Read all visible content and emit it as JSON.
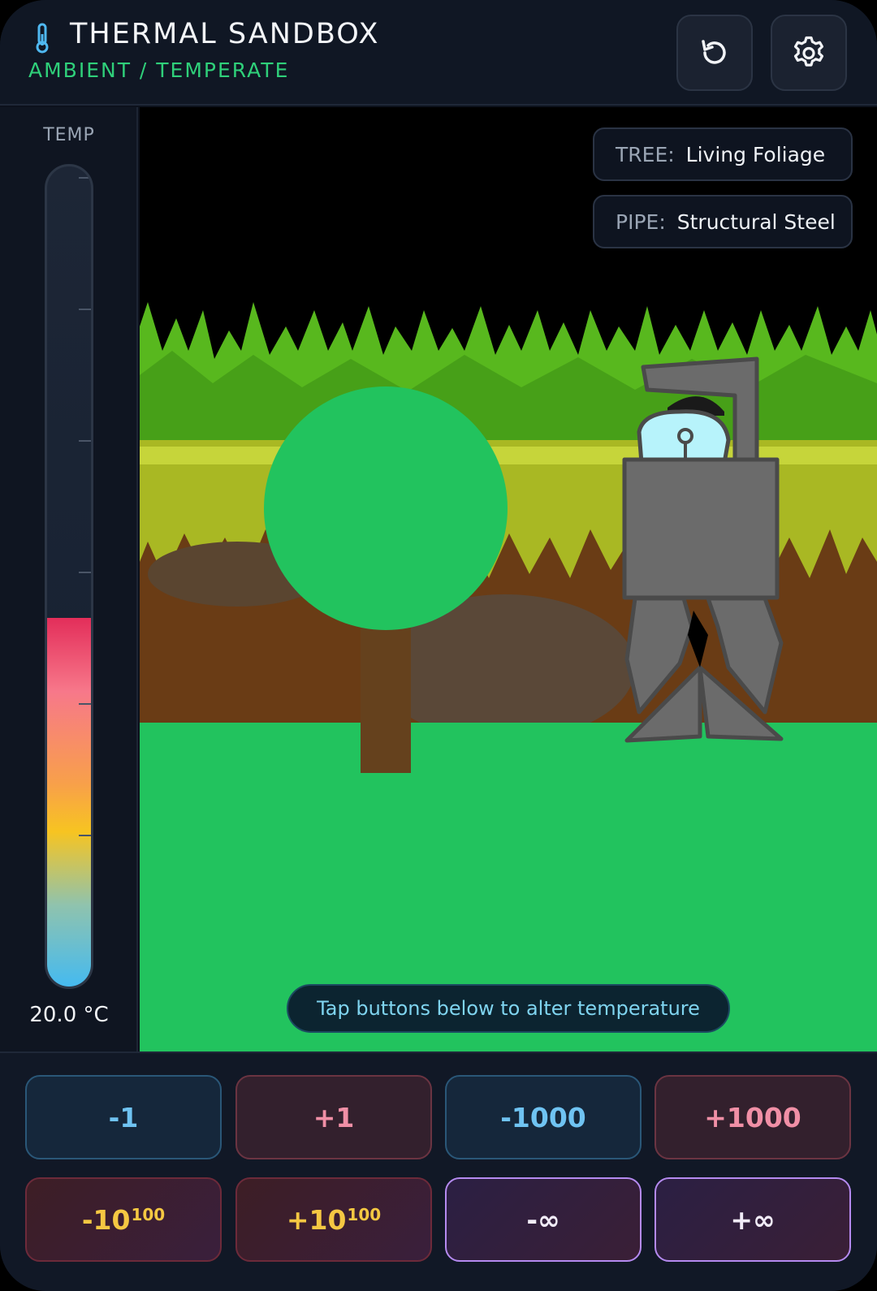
{
  "header": {
    "title": "THERMAL SANDBOX",
    "subtitle": "AMBIENT / TEMPERATE",
    "reset_icon": "reset-icon",
    "settings_icon": "gear-icon"
  },
  "thermometer": {
    "label": "TEMP",
    "readout": "20.0 °C",
    "fill_fraction": 0.45
  },
  "scene": {
    "tree_tag": {
      "key": "TREE:",
      "value": "Living Foliage"
    },
    "pipe_tag": {
      "key": "PIPE:",
      "value": "Structural Steel"
    },
    "hint": "Tap buttons below to alter temperature"
  },
  "controls": {
    "minus_1": "-1",
    "plus_1": "+1",
    "minus_1000": "-1000",
    "plus_1000": "+1000",
    "minus_googol_base": "-10",
    "plus_googol_base": "+10",
    "googol_exponent": "100",
    "minus_inf": "-∞",
    "plus_inf": "+∞"
  },
  "colors": {
    "accent_green": "#2fd07a",
    "cold": "#6fc3f2",
    "hot": "#f08fa6",
    "gold": "#f5c842",
    "purple": "#b58af0"
  }
}
